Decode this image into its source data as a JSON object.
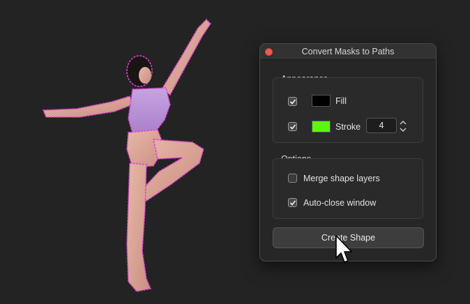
{
  "dialog": {
    "title": "Convert Masks to Paths",
    "appearance": {
      "label": "Appearance",
      "fill": {
        "label": "Fill",
        "checked": true,
        "color": "#000000"
      },
      "stroke": {
        "label": "Stroke",
        "checked": true,
        "color": "#5cf50f",
        "width": "4"
      }
    },
    "options": {
      "label": "Options",
      "merge": {
        "label": "Merge shape layers",
        "checked": false
      },
      "autoclose": {
        "label": "Auto-close window",
        "checked": true
      }
    },
    "create_label": "Create Shape"
  },
  "colors": {
    "mask_outline": "#e040d6",
    "close_button": "#ee5a52",
    "background": "#232323"
  }
}
